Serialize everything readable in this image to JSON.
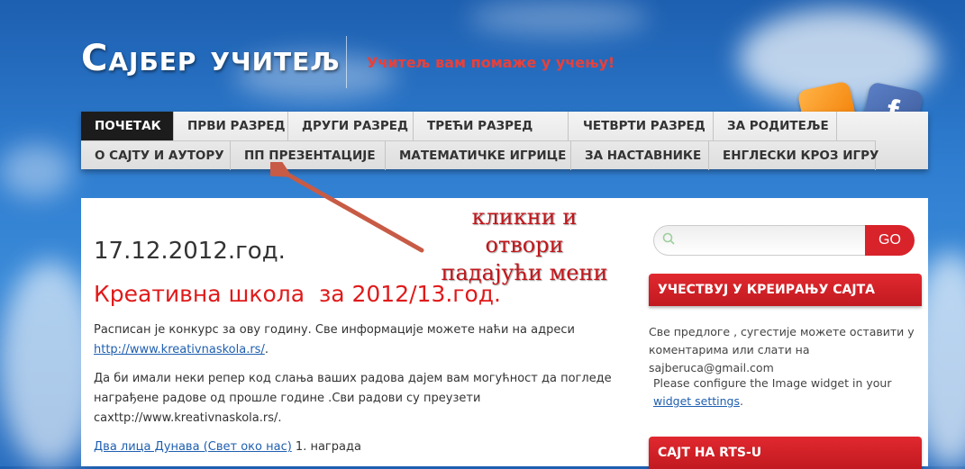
{
  "header": {
    "site_title": "Сајбер учитељ",
    "tagline": "Учитељ вам помаже у учењу!"
  },
  "social": {
    "facebook_glyph": "f"
  },
  "nav": {
    "row1": [
      "ПОЧЕТАК",
      "ПРВИ РАЗРЕД",
      "ДРУГИ РАЗРЕД",
      "ТРЕЋИ РАЗРЕД",
      "ЧЕТВРТИ РАЗРЕД",
      "ЗА РОДИТЕЉЕ"
    ],
    "row2": [
      "О САЈТУ И АУТОРУ",
      "ПП ПРЕЗЕНТАЦИЈЕ",
      "МАТЕМАТИЧКЕ ИГРИЦЕ",
      "ЗА НАСТАВНИКЕ",
      "ЕНГЛЕСКИ КРОЗ ИГРУ"
    ],
    "active": "ПОЧЕТАК"
  },
  "post": {
    "date": "17.12.2012.год.",
    "title": "Креативна школа  за 2012/13.год.",
    "p1_text": "Расписан је конкурс за ову годину. Све информације можете наћи на адреси ",
    "p1_link": "http://www.kreativnaskola.rs/",
    "p1_end": ".",
    "p2_text": "Да би имали неки репер код слања ваших радова дајем вам могућност да погледе награђене радове од прошле године .Сви радови су преузети сахttp://www.kreativnaskola.rs/.",
    "p3_link": "Два лица Дунава (Свет око нас)",
    "p3_text": " 1. награда"
  },
  "annotation": {
    "line1": "кликни и",
    "line2": "отвори",
    "line3": "падајући мени"
  },
  "sidebar": {
    "search_placeholder": "",
    "go_label": "GO",
    "widget1_title": "УЧЕСТВУЈ У КРЕИРАЊУ САЈТА",
    "widget1_text": "Све предлоге , сугестије можете оставити у коментарима или слати на sajberuca@gmail.com",
    "widget2_text": "Please configure the Image widget in your ",
    "widget2_link": "widget settings",
    "widget2_end": ".",
    "widget3_title": "САЈТ НА RTS-U"
  },
  "colors": {
    "accent_red": "#d8232a",
    "tagline": "#e8403a",
    "link": "#1f5fb0"
  }
}
